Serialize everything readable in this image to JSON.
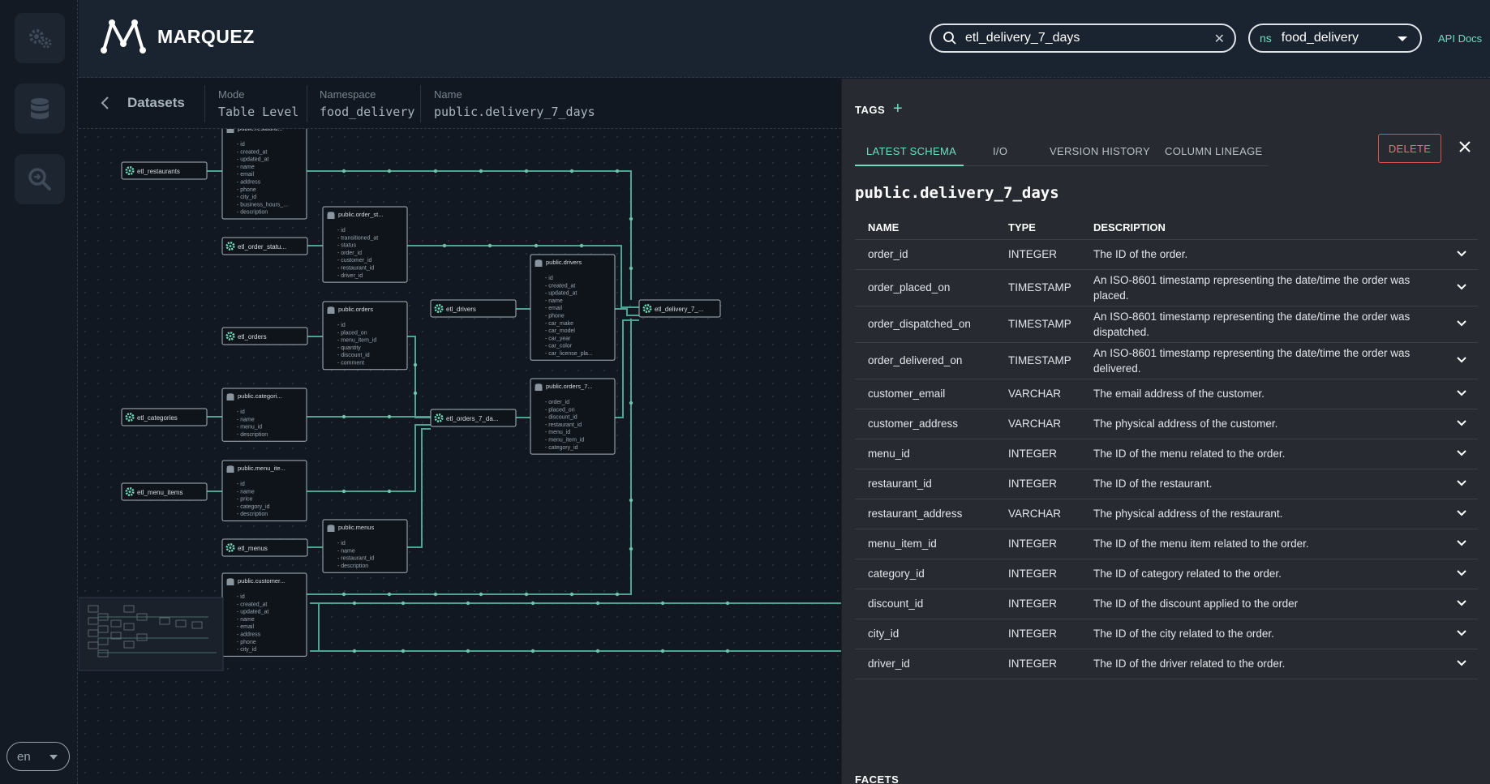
{
  "app": {
    "name": "MARQUEZ"
  },
  "header": {
    "search_value": "etl_delivery_7_days",
    "namespace_prefix": "ns",
    "namespace_value": "food_delivery",
    "api_docs_label": "API Docs"
  },
  "sidebar": {
    "language": "en"
  },
  "toolbar": {
    "title": "Datasets",
    "mode_label": "Mode",
    "mode_value": "Table Level",
    "namespace_label": "Namespace",
    "namespace_value": "food_delivery",
    "name_label": "Name",
    "name_value": "public.delivery_7_days"
  },
  "graph": {
    "jobs": [
      {
        "id": "etl_restaurants",
        "label": "etl_restaurants"
      },
      {
        "id": "etl_order_status",
        "label": "etl_order_statu..."
      },
      {
        "id": "etl_orders",
        "label": "etl_orders"
      },
      {
        "id": "etl_categories",
        "label": "etl_categories"
      },
      {
        "id": "etl_menu_items",
        "label": "etl_menu_items"
      },
      {
        "id": "etl_menus",
        "label": "etl_menus"
      },
      {
        "id": "etl_drivers",
        "label": "etl_drivers"
      },
      {
        "id": "etl_orders_7_days",
        "label": "etl_orders_7_da..."
      },
      {
        "id": "etl_delivery_7_days",
        "label": "etl_delivery_7_..."
      }
    ],
    "datasets": [
      {
        "id": "restaurants",
        "label": "public.restaura...",
        "fields": [
          "- id",
          "- created_at",
          "- updated_at",
          "- name",
          "- email",
          "- address",
          "- phone",
          "- city_id",
          "- business_hours_...",
          "- description"
        ]
      },
      {
        "id": "order_status",
        "label": "public.order_st...",
        "fields": [
          "- id",
          "- transitioned_at",
          "- status",
          "- order_id",
          "- customer_id",
          "- restaurant_id",
          "- driver_id"
        ]
      },
      {
        "id": "orders",
        "label": "public.orders",
        "fields": [
          "- id",
          "- placed_on",
          "- menu_item_id",
          "- quantity",
          "- discount_id",
          "- comment"
        ]
      },
      {
        "id": "categories",
        "label": "public.categori...",
        "fields": [
          "- id",
          "- name",
          "- menu_id",
          "- description"
        ]
      },
      {
        "id": "menu_items",
        "label": "public.menu_ite...",
        "fields": [
          "- id",
          "- name",
          "- price",
          "- category_id",
          "- description"
        ]
      },
      {
        "id": "menus",
        "label": "public.menus",
        "fields": [
          "- id",
          "- name",
          "- restaurant_id",
          "- description"
        ]
      },
      {
        "id": "customers",
        "label": "public.customer...",
        "fields": [
          "- id",
          "- created_at",
          "- updated_at",
          "- name",
          "- email",
          "- address",
          "- phone",
          "- city_id"
        ]
      },
      {
        "id": "drivers",
        "label": "public.drivers",
        "fields": [
          "- id",
          "- created_at",
          "- updated_at",
          "- name",
          "- email",
          "- phone",
          "- car_make",
          "- car_model",
          "- car_year",
          "- car_color",
          "- car_license_pla..."
        ]
      },
      {
        "id": "orders_7_days",
        "label": "public.orders_7...",
        "fields": [
          "- order_id",
          "- placed_on",
          "- discount_id",
          "- restaurant_id",
          "- menu_id",
          "- menu_item_id",
          "- category_id"
        ]
      }
    ]
  },
  "drawer": {
    "tags_label": "TAGS",
    "tabs": [
      {
        "label": "LATEST SCHEMA"
      },
      {
        "label": "I/O"
      },
      {
        "label": "VERSION HISTORY"
      },
      {
        "label": "COLUMN LINEAGE"
      }
    ],
    "delete_label": "DELETE",
    "dataset_title": "public.delivery_7_days",
    "columns": {
      "name": "NAME",
      "type": "TYPE",
      "description": "DESCRIPTION"
    },
    "rows": [
      {
        "name": "order_id",
        "type": "INTEGER",
        "description": "The ID of the order."
      },
      {
        "name": "order_placed_on",
        "type": "TIMESTAMP",
        "description": "An ISO-8601 timestamp representing the date/time the order was placed."
      },
      {
        "name": "order_dispatched_on",
        "type": "TIMESTAMP",
        "description": "An ISO-8601 timestamp representing the date/time the order was dispatched."
      },
      {
        "name": "order_delivered_on",
        "type": "TIMESTAMP",
        "description": "An ISO-8601 timestamp representing the date/time the order was delivered."
      },
      {
        "name": "customer_email",
        "type": "VARCHAR",
        "description": "The email address of the customer."
      },
      {
        "name": "customer_address",
        "type": "VARCHAR",
        "description": "The physical address of the customer."
      },
      {
        "name": "menu_id",
        "type": "INTEGER",
        "description": "The ID of the menu related to the order."
      },
      {
        "name": "restaurant_id",
        "type": "INTEGER",
        "description": "The ID of the restaurant."
      },
      {
        "name": "restaurant_address",
        "type": "VARCHAR",
        "description": "The physical address of the restaurant."
      },
      {
        "name": "menu_item_id",
        "type": "INTEGER",
        "description": "The ID of the menu item related to the order."
      },
      {
        "name": "category_id",
        "type": "INTEGER",
        "description": "The ID of category related to the order."
      },
      {
        "name": "discount_id",
        "type": "INTEGER",
        "description": "The ID of the discount applied to the order"
      },
      {
        "name": "city_id",
        "type": "INTEGER",
        "description": "The ID of the city related to the order."
      },
      {
        "name": "driver_id",
        "type": "INTEGER",
        "description": "The ID of the driver related to the order."
      }
    ],
    "facets_label": "FACETS"
  },
  "colors": {
    "accent": "#71ddbf",
    "edge": "#4fa391",
    "danger": "#d9534f"
  }
}
